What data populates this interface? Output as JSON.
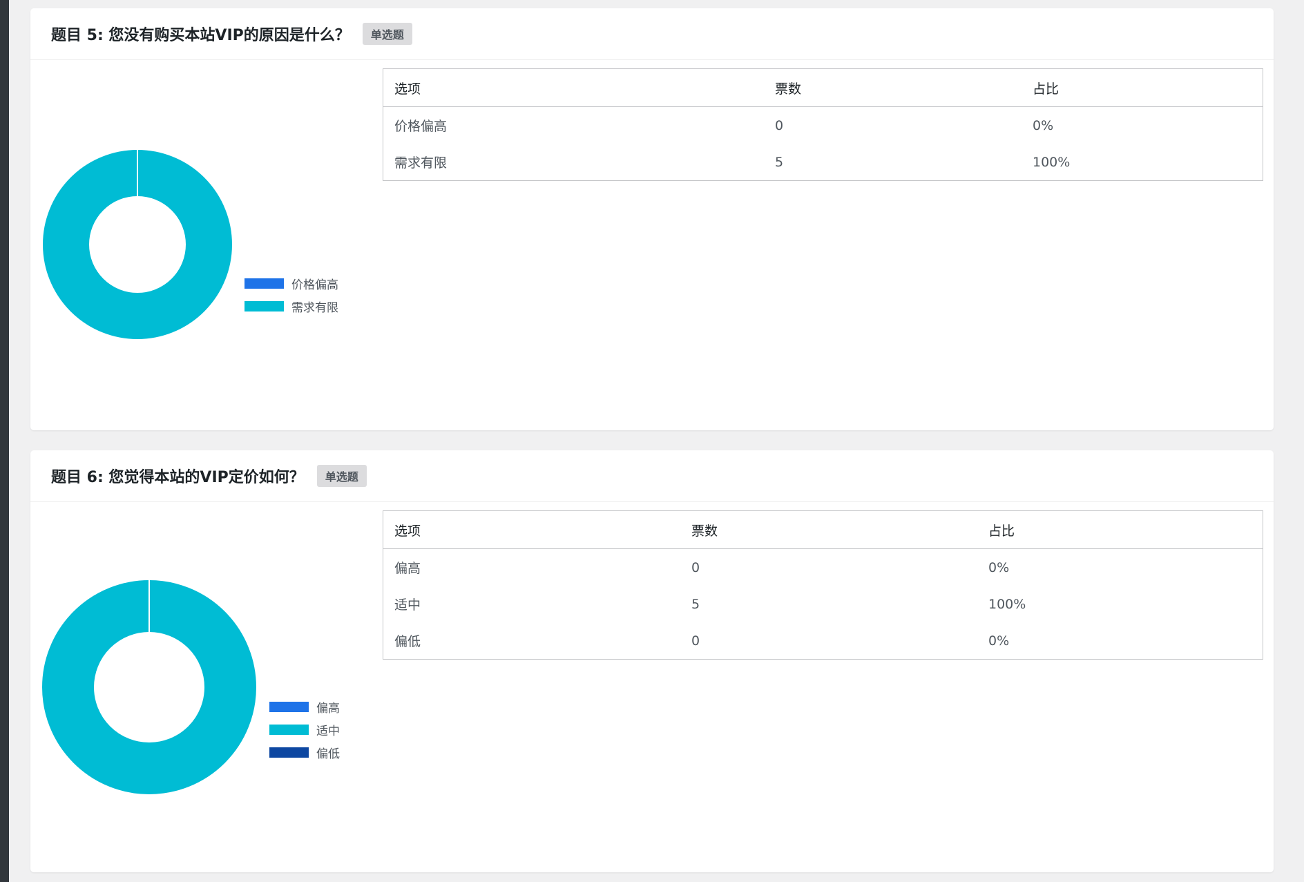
{
  "questions": [
    {
      "title": "题目 5: 您没有购买本站VIP的原因是什么？",
      "type": "单选题",
      "columns": [
        "选项",
        "票数",
        "占比"
      ],
      "rows": [
        {
          "option": "价格偏高",
          "votes": "0",
          "percent": "0%"
        },
        {
          "option": "需求有限",
          "votes": "5",
          "percent": "100%"
        }
      ],
      "legend": [
        {
          "label": "价格偏高",
          "color": "#1e73e8"
        },
        {
          "label": "需求有限",
          "color": "#00bcd4"
        }
      ]
    },
    {
      "title": "题目 6: 您觉得本站的VIP定价如何？",
      "type": "单选题",
      "columns": [
        "选项",
        "票数",
        "占比"
      ],
      "rows": [
        {
          "option": "偏高",
          "votes": "0",
          "percent": "0%"
        },
        {
          "option": "适中",
          "votes": "5",
          "percent": "100%"
        },
        {
          "option": "偏低",
          "votes": "0",
          "percent": "0%"
        }
      ],
      "legend": [
        {
          "label": "偏高",
          "color": "#1e73e8"
        },
        {
          "label": "适中",
          "color": "#00bcd4"
        },
        {
          "label": "偏低",
          "color": "#0d47a1"
        }
      ]
    }
  ],
  "chart_data": [
    {
      "type": "pie",
      "categories": [
        "价格偏高",
        "需求有限"
      ],
      "values": [
        0,
        5
      ],
      "colors": [
        "#1e73e8",
        "#00bcd4"
      ],
      "legend": "right"
    },
    {
      "type": "pie",
      "categories": [
        "偏高",
        "适中",
        "偏低"
      ],
      "values": [
        0,
        5,
        0
      ],
      "colors": [
        "#1e73e8",
        "#00bcd4",
        "#0d47a1"
      ],
      "legend": "right"
    }
  ]
}
